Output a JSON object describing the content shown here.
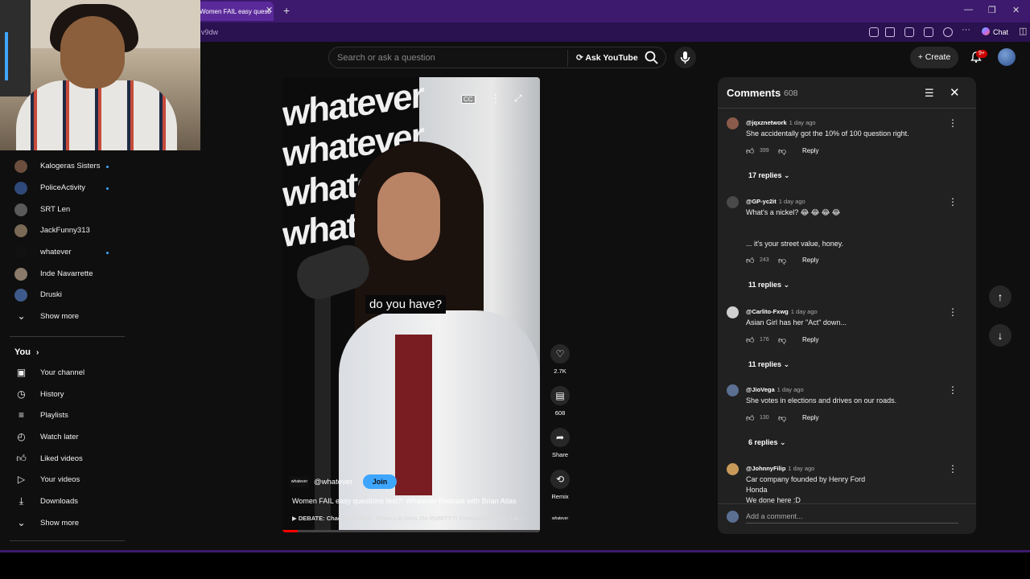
{
  "browser": {
    "tab_title": "Women FAIL easy questi",
    "url_fragment": "v9dw",
    "chat_label": "Chat"
  },
  "header": {
    "search_placeholder": "Search or ask a question",
    "ask_label": "Ask YouTube",
    "create_label": "Create",
    "notification_count": "9+"
  },
  "sidebar": {
    "subscriptions": [
      {
        "name": "Kalogeras Sisters",
        "new": true,
        "color": "#6b4e3d"
      },
      {
        "name": "PoliceActivity",
        "new": true,
        "color": "#2f4a7a"
      },
      {
        "name": "SRT Len",
        "new": false,
        "color": "#5a5a5a"
      },
      {
        "name": "JackFunny313",
        "new": false,
        "color": "#7a6a55"
      },
      {
        "name": "whatever",
        "new": true,
        "color": "#111111"
      },
      {
        "name": "Inde Navarrette",
        "new": false,
        "color": "#8a7a6a"
      },
      {
        "name": "Druski",
        "new": false,
        "color": "#3e5a8a"
      }
    ],
    "show_more_1": "Show more",
    "you_heading": "You",
    "you_items": [
      {
        "label": "Your channel",
        "icon": "person-icon"
      },
      {
        "label": "History",
        "icon": "history-icon"
      },
      {
        "label": "Playlists",
        "icon": "playlists-icon"
      },
      {
        "label": "Watch later",
        "icon": "clock-icon"
      },
      {
        "label": "Liked videos",
        "icon": "thumbs-up-icon"
      },
      {
        "label": "Your videos",
        "icon": "play-icon"
      },
      {
        "label": "Downloads",
        "icon": "download-icon"
      }
    ],
    "show_more_2": "Show more"
  },
  "video": {
    "caption": "do you have?",
    "background_word": "whatever",
    "channel_handle": "@whatever",
    "channel_avatar_text": "whatever",
    "join_label": "Join",
    "title": "Women FAIL easy questions test?! Whatever Podcast with Brian Atlas",
    "playlist": "DEBATE: Chad VIRGIN vs. Woke Lib Girls On PURITY?! Feminists MAD?! LA ...",
    "cc_label": "CC",
    "progress": 0.06
  },
  "actions": {
    "likes": "2.7K",
    "comments": "608",
    "share": "Share",
    "remix": "Remix"
  },
  "comments": {
    "title": "Comments",
    "count": "608",
    "items": [
      {
        "author": "@jqxznetwork",
        "time": "1 day ago",
        "text": "She accidentally got the 10% of 100 question right.",
        "likes": "399",
        "replies": "17 replies",
        "color": "#8a5a4a"
      },
      {
        "author": "@GP-yc2it",
        "time": "1 day ago",
        "text": "What's a nickel? 😂 😂 😂 😂\n\n\n... it's your street value, honey.",
        "likes": "243",
        "replies": "11 replies",
        "color": "#4a4a4a"
      },
      {
        "author": "@Carlito-Fxwg",
        "time": "1 day ago",
        "text": "Asian Girl has her \"Act\" down...",
        "likes": "176",
        "replies": "11 replies",
        "color": "#d0d0d0"
      },
      {
        "author": "@JioVega",
        "time": "1 day ago",
        "text": "She votes in elections and drives on our roads.",
        "likes": "130",
        "replies": "6 replies",
        "color": "#5a6f92"
      },
      {
        "author": "@JohnnyFilip",
        "time": "1 day ago",
        "text": "Car company founded by Henry Ford\nHonda\nWe done here :D",
        "likes": "",
        "replies": "",
        "color": "#c89a5a"
      }
    ],
    "reply_label": "Reply",
    "add_placeholder": "Add a comment..."
  }
}
